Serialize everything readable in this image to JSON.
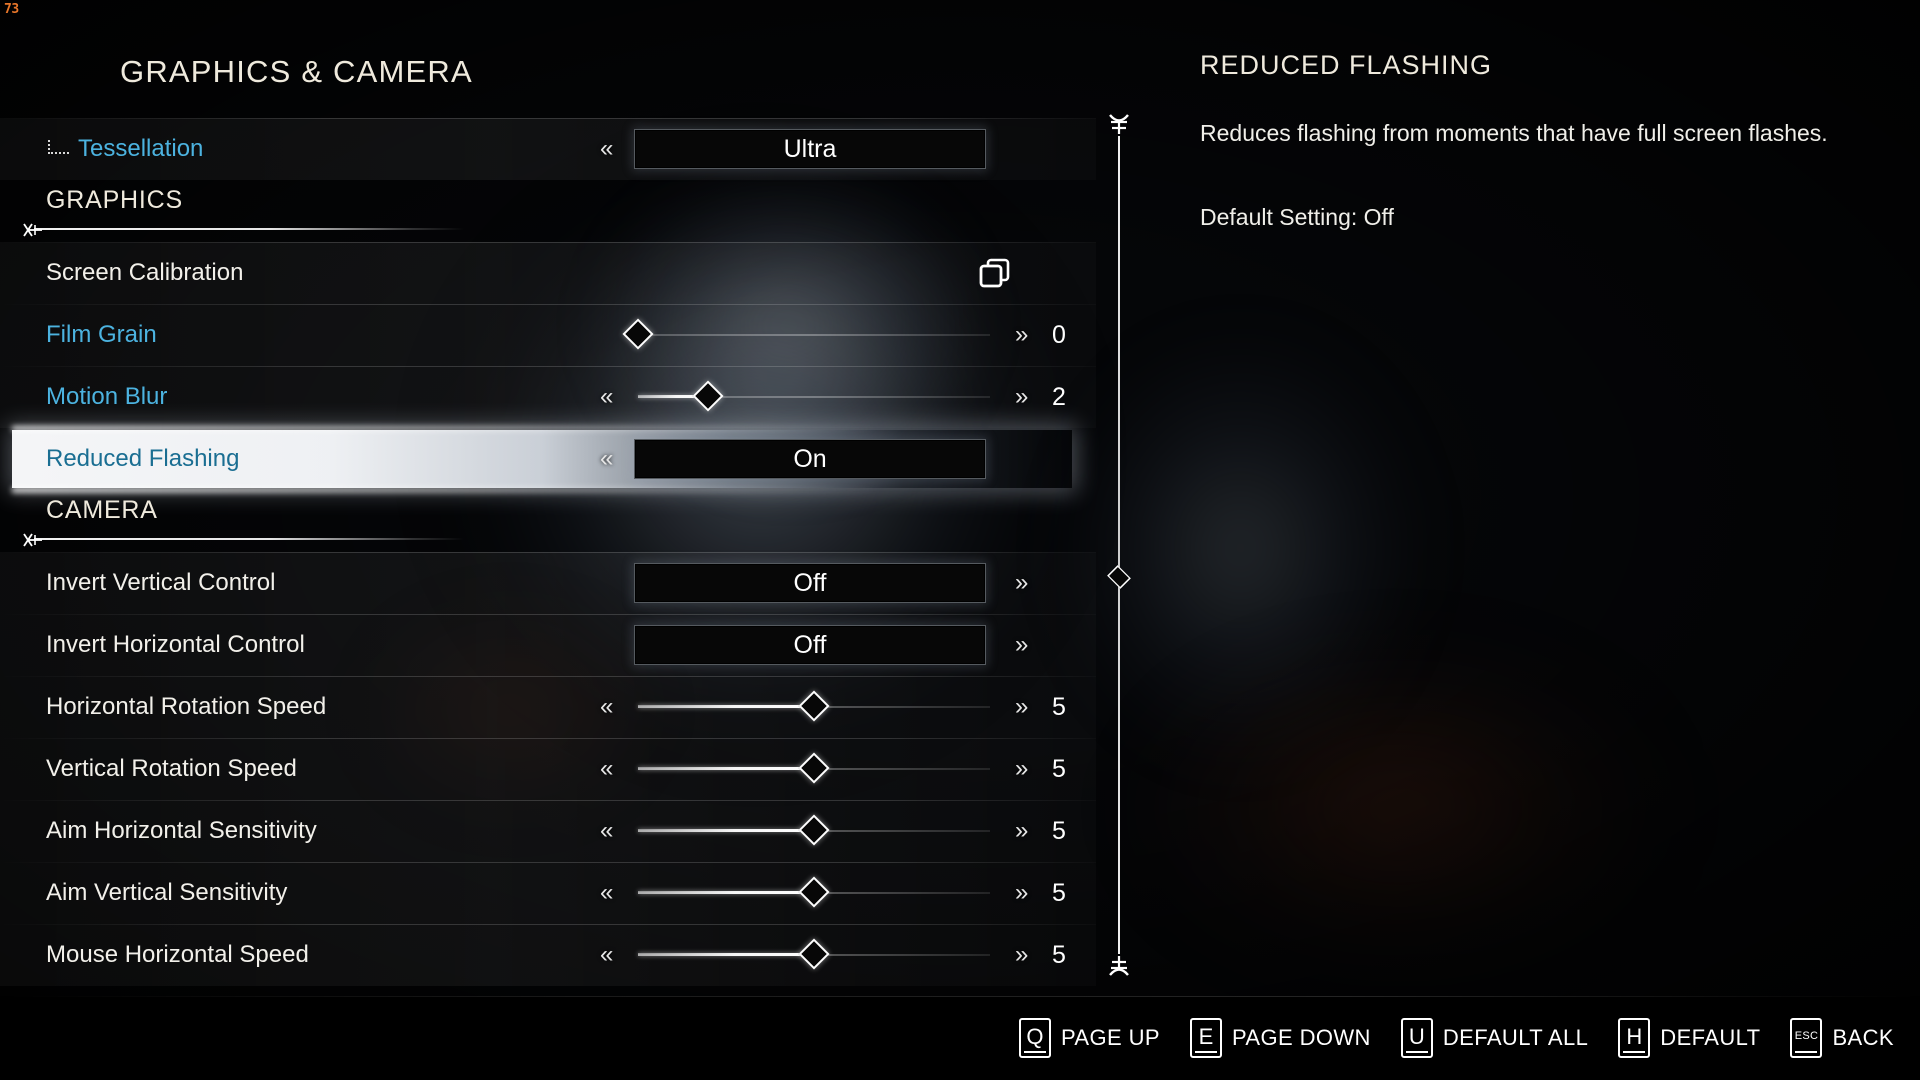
{
  "hud": {
    "fps": "73"
  },
  "page_title": "GRAPHICS & CAMERA",
  "rows": [
    {
      "label": "Tessellation",
      "type": "option",
      "value": "Ultra",
      "blue": true,
      "child": true,
      "left_chevron": true,
      "right_chevron": false
    },
    {
      "label": "GRAPHICS",
      "type": "section"
    },
    {
      "label": "Screen Calibration",
      "type": "icon",
      "icon": "copy-layers-icon"
    },
    {
      "label": "Film Grain",
      "type": "slider",
      "value": "0",
      "blue": true,
      "percent": 0,
      "left_chevron": false,
      "right_chevron": true
    },
    {
      "label": "Motion Blur",
      "type": "slider",
      "value": "2",
      "blue": true,
      "percent": 20,
      "left_chevron": true,
      "right_chevron": true
    },
    {
      "label": "Reduced Flashing",
      "type": "option",
      "value": "On",
      "blue": true,
      "selected": true,
      "left_chevron": true,
      "right_chevron": false
    },
    {
      "label": "CAMERA",
      "type": "section"
    },
    {
      "label": "Invert Vertical Control",
      "type": "option",
      "value": "Off",
      "left_chevron": false,
      "right_chevron": true
    },
    {
      "label": "Invert Horizontal Control",
      "type": "option",
      "value": "Off",
      "left_chevron": false,
      "right_chevron": true
    },
    {
      "label": "Horizontal Rotation Speed",
      "type": "slider",
      "value": "5",
      "percent": 50,
      "left_chevron": true,
      "right_chevron": true
    },
    {
      "label": "Vertical Rotation Speed",
      "type": "slider",
      "value": "5",
      "percent": 50,
      "left_chevron": true,
      "right_chevron": true
    },
    {
      "label": "Aim Horizontal Sensitivity",
      "type": "slider",
      "value": "5",
      "percent": 50,
      "left_chevron": true,
      "right_chevron": true
    },
    {
      "label": "Aim Vertical Sensitivity",
      "type": "slider",
      "value": "5",
      "percent": 50,
      "left_chevron": true,
      "right_chevron": true
    },
    {
      "label": "Mouse Horizontal Speed",
      "type": "slider",
      "value": "5",
      "percent": 50,
      "left_chevron": true,
      "right_chevron": true
    }
  ],
  "description": {
    "title": "REDUCED FLASHING",
    "body": "Reduces flashing from moments that have full screen flashes.",
    "default_setting": "Default Setting: Off"
  },
  "chevrons": {
    "left": "«",
    "right": "»"
  },
  "footer": {
    "hints": [
      {
        "key": "Q",
        "label": "PAGE UP"
      },
      {
        "key": "E",
        "label": "PAGE DOWN"
      },
      {
        "key": "U",
        "label": "DEFAULT ALL"
      },
      {
        "key": "H",
        "label": "DEFAULT"
      },
      {
        "key": "ESC",
        "label": "BACK"
      }
    ]
  },
  "colors": {
    "accent_blue": "#4cb3e0",
    "selected_text": "#1a6e92",
    "title_cream": "#efeadd",
    "fps_orange": "#e8762a"
  }
}
